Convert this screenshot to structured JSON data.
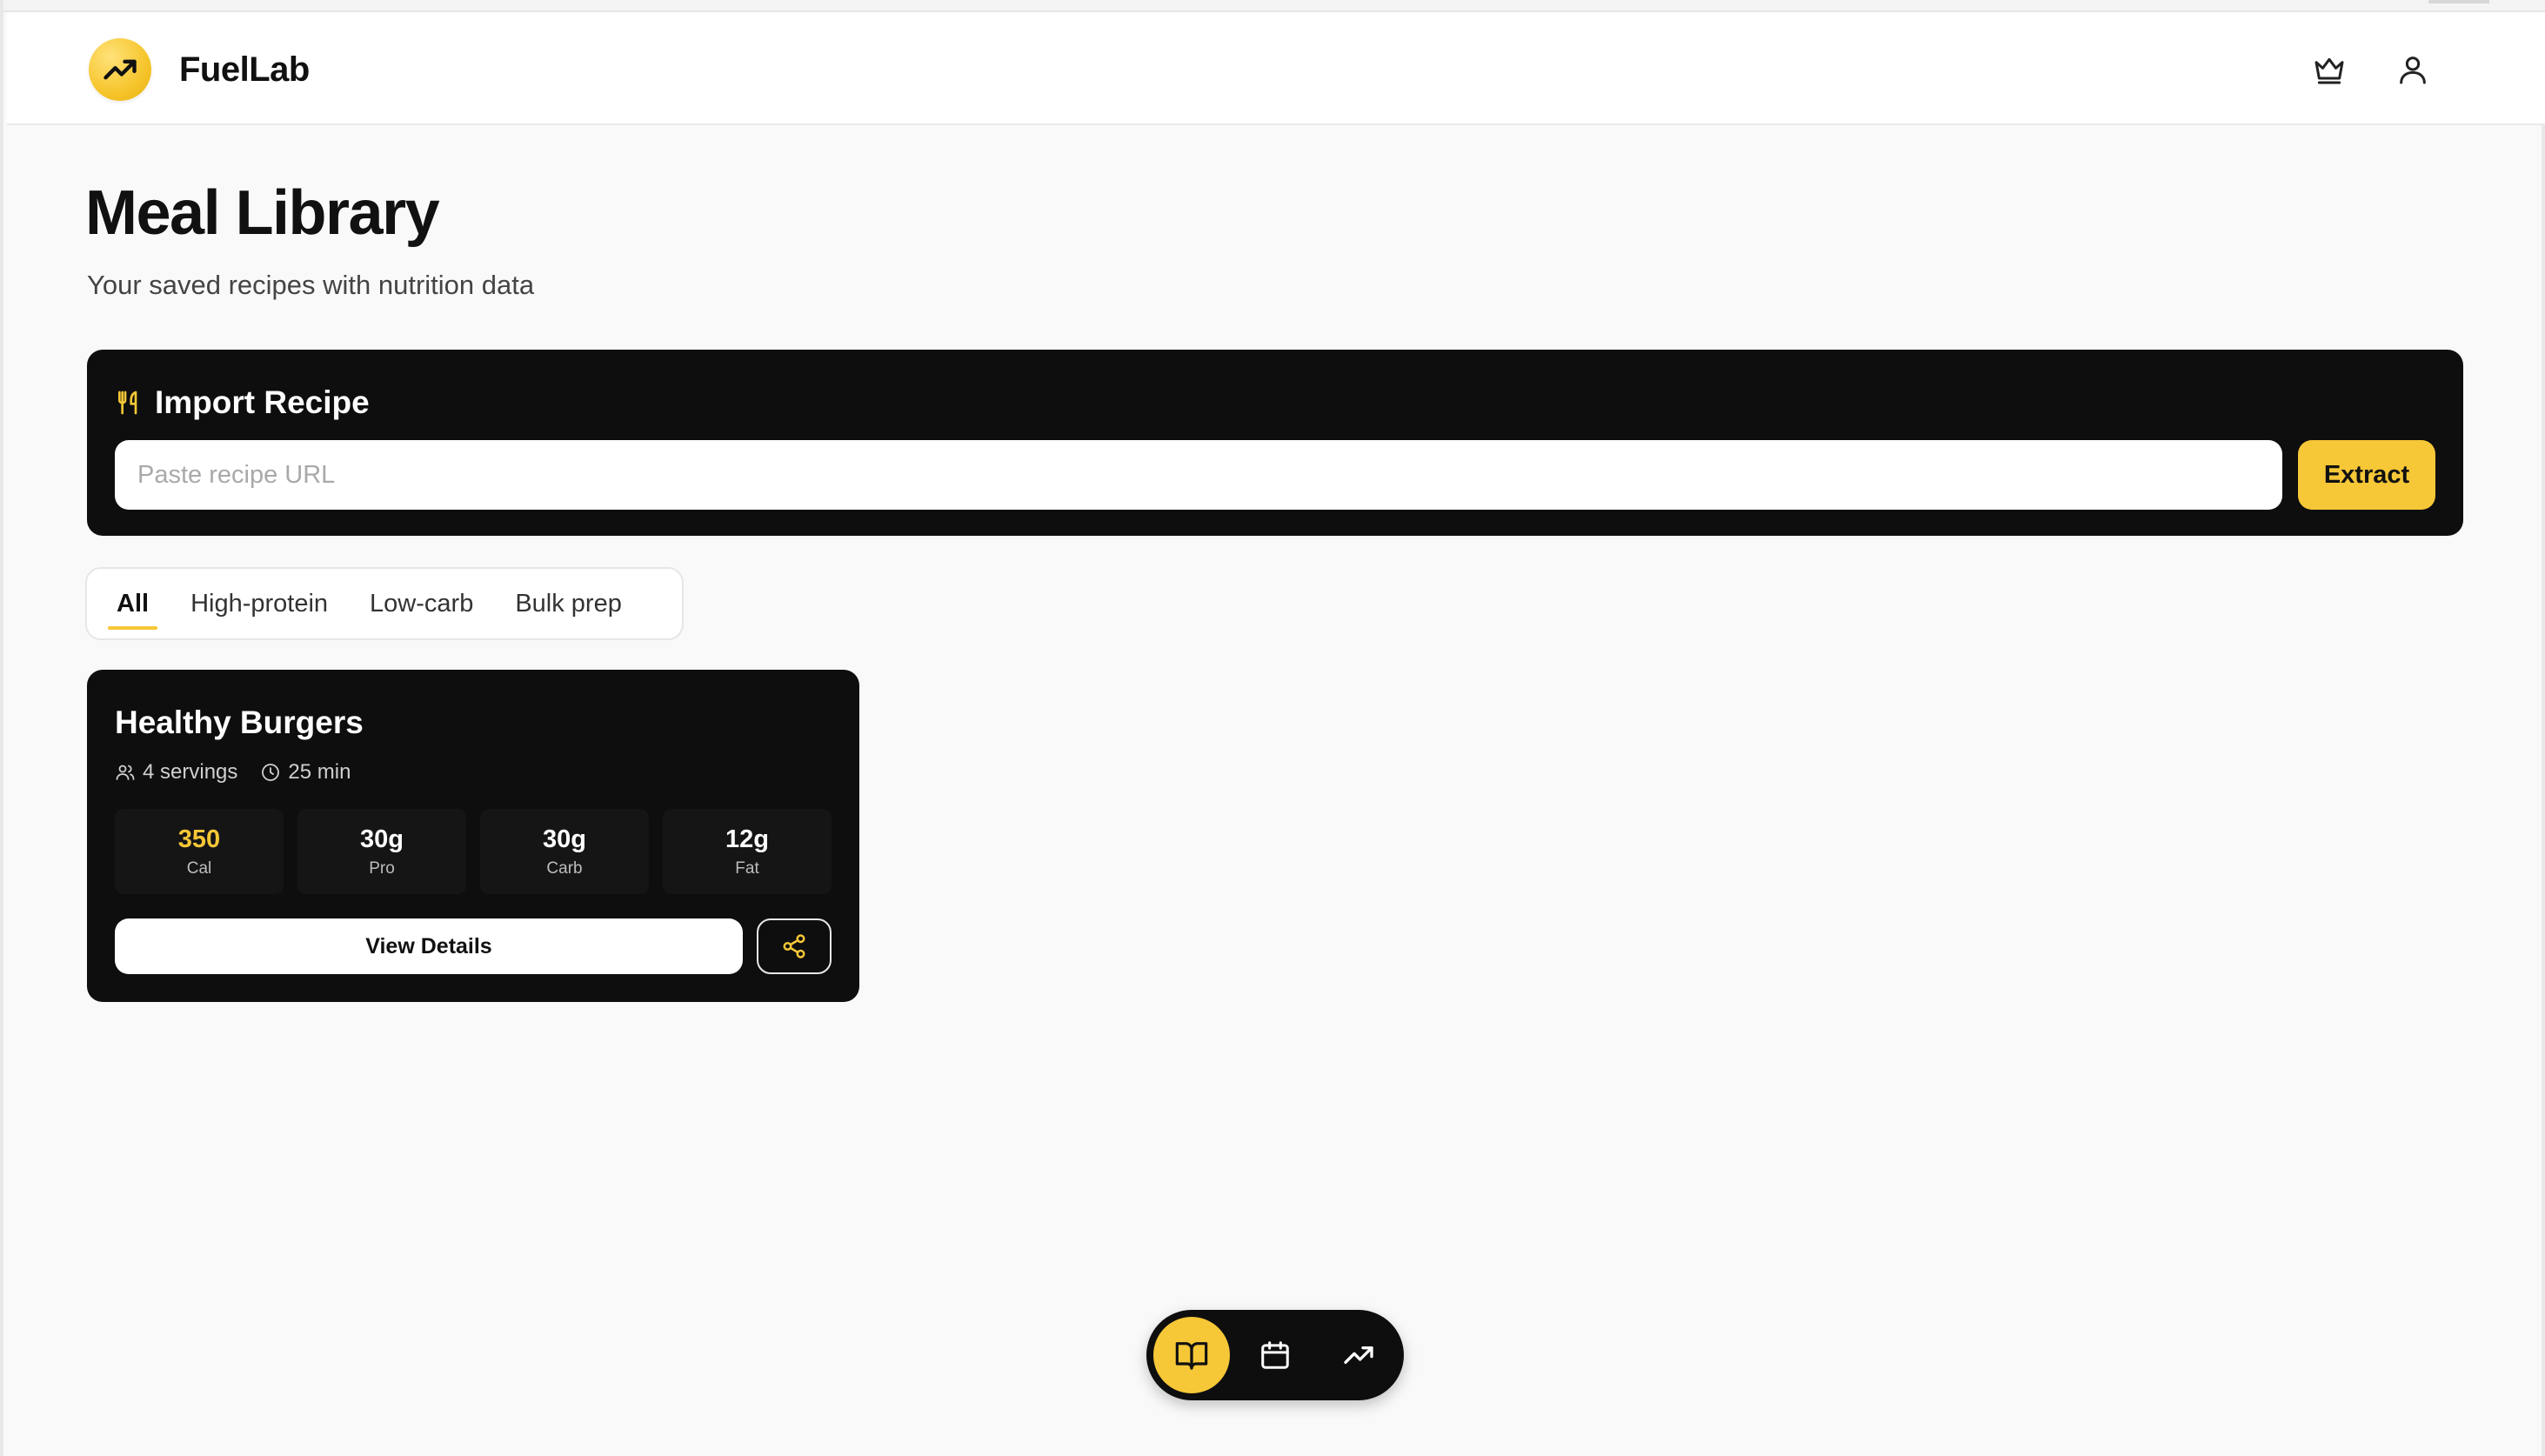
{
  "app": {
    "brand": "FuelLab"
  },
  "header": {
    "icons": [
      "crown-icon",
      "user-icon"
    ]
  },
  "page": {
    "title": "Meal Library",
    "subtitle": "Your saved recipes with nutrition data"
  },
  "import": {
    "title": "Import Recipe",
    "icon": "utensils-icon",
    "input_value": "",
    "placeholder": "Paste recipe URL",
    "button_label": "Extract"
  },
  "filters": {
    "tabs": [
      {
        "label": "All",
        "active": true
      },
      {
        "label": "High-protein",
        "active": false
      },
      {
        "label": "Low-carb",
        "active": false
      },
      {
        "label": "Bulk prep",
        "active": false
      }
    ]
  },
  "recipes": [
    {
      "title": "Healthy Burgers",
      "servings": "4 servings",
      "time": "25 min",
      "macros": [
        {
          "value": "350",
          "label": "Cal"
        },
        {
          "value": "30g",
          "label": "Pro"
        },
        {
          "value": "30g",
          "label": "Carb"
        },
        {
          "value": "12g",
          "label": "Fat"
        }
      ],
      "view_label": "View Details"
    }
  ],
  "bottom_nav": {
    "items": [
      {
        "icon": "book-open-icon",
        "active": true
      },
      {
        "icon": "calendar-icon",
        "active": false
      },
      {
        "icon": "trending-up-icon",
        "active": false
      }
    ]
  },
  "colors": {
    "accent": "#f6c737",
    "card": "#0e0e0f",
    "background": "#f9f9f9"
  }
}
